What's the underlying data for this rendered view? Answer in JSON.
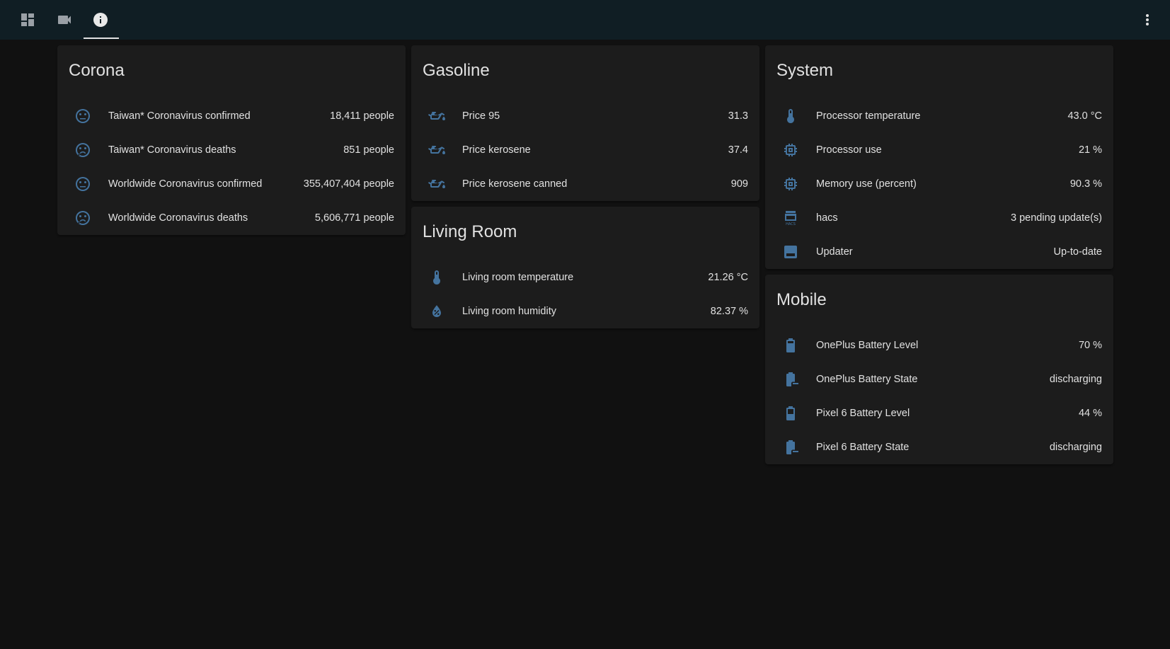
{
  "toolbar": {
    "tabs": [
      {
        "icon": "dashboard-icon",
        "active": false
      },
      {
        "icon": "cctv-icon",
        "active": false
      },
      {
        "icon": "info-icon",
        "active": true
      }
    ],
    "menu_icon": "dots-vertical-icon"
  },
  "colors": {
    "background": "#111111",
    "toolbar": "#101e24",
    "card": "#1c1c1c",
    "icon": "#44739e",
    "text": "#e1e1e1"
  },
  "cards": {
    "corona": {
      "title": "Corona",
      "rows": [
        {
          "icon": "emoticon-neutral-icon",
          "name": "Taiwan* Coronavirus confirmed",
          "value": "18,411 people"
        },
        {
          "icon": "emoticon-cry-icon",
          "name": "Taiwan* Coronavirus deaths",
          "value": "851 people"
        },
        {
          "icon": "emoticon-neutral-icon",
          "name": "Worldwide Coronavirus confirmed",
          "value": "355,407,404 people"
        },
        {
          "icon": "emoticon-cry-icon",
          "name": "Worldwide Coronavirus deaths",
          "value": "5,606,771 people"
        }
      ]
    },
    "gasoline": {
      "title": "Gasoline",
      "rows": [
        {
          "icon": "oil-icon",
          "name": "Price 95",
          "value": "31.3"
        },
        {
          "icon": "oil-icon",
          "name": "Price kerosene",
          "value": "37.4"
        },
        {
          "icon": "oil-icon",
          "name": "Price kerosene canned",
          "value": "909"
        }
      ]
    },
    "living_room": {
      "title": "Living Room",
      "rows": [
        {
          "icon": "thermometer-icon",
          "name": "Living room temperature",
          "value": "21.26 °C"
        },
        {
          "icon": "water-percent-icon",
          "name": "Living room humidity",
          "value": "82.37 %"
        }
      ]
    },
    "system": {
      "title": "System",
      "rows": [
        {
          "icon": "thermometer-icon",
          "name": "Processor temperature",
          "value": "43.0 °C"
        },
        {
          "icon": "cpu-icon",
          "name": "Processor use",
          "value": "21 %"
        },
        {
          "icon": "memory-icon",
          "name": "Memory use (percent)",
          "value": "90.3 %"
        },
        {
          "icon": "hacs-icon",
          "name": "hacs",
          "value": "3 pending update(s)"
        },
        {
          "icon": "package-icon",
          "name": "Updater",
          "value": "Up-to-date"
        }
      ]
    },
    "mobile": {
      "title": "Mobile",
      "rows": [
        {
          "icon": "battery-icon",
          "name": "OnePlus Battery Level",
          "value": "70 %"
        },
        {
          "icon": "battery-minus-icon",
          "name": "OnePlus Battery State",
          "value": "discharging"
        },
        {
          "icon": "battery-icon",
          "name": "Pixel 6 Battery Level",
          "value": "44 %"
        },
        {
          "icon": "battery-minus-icon",
          "name": "Pixel 6 Battery State",
          "value": "discharging"
        }
      ]
    }
  }
}
